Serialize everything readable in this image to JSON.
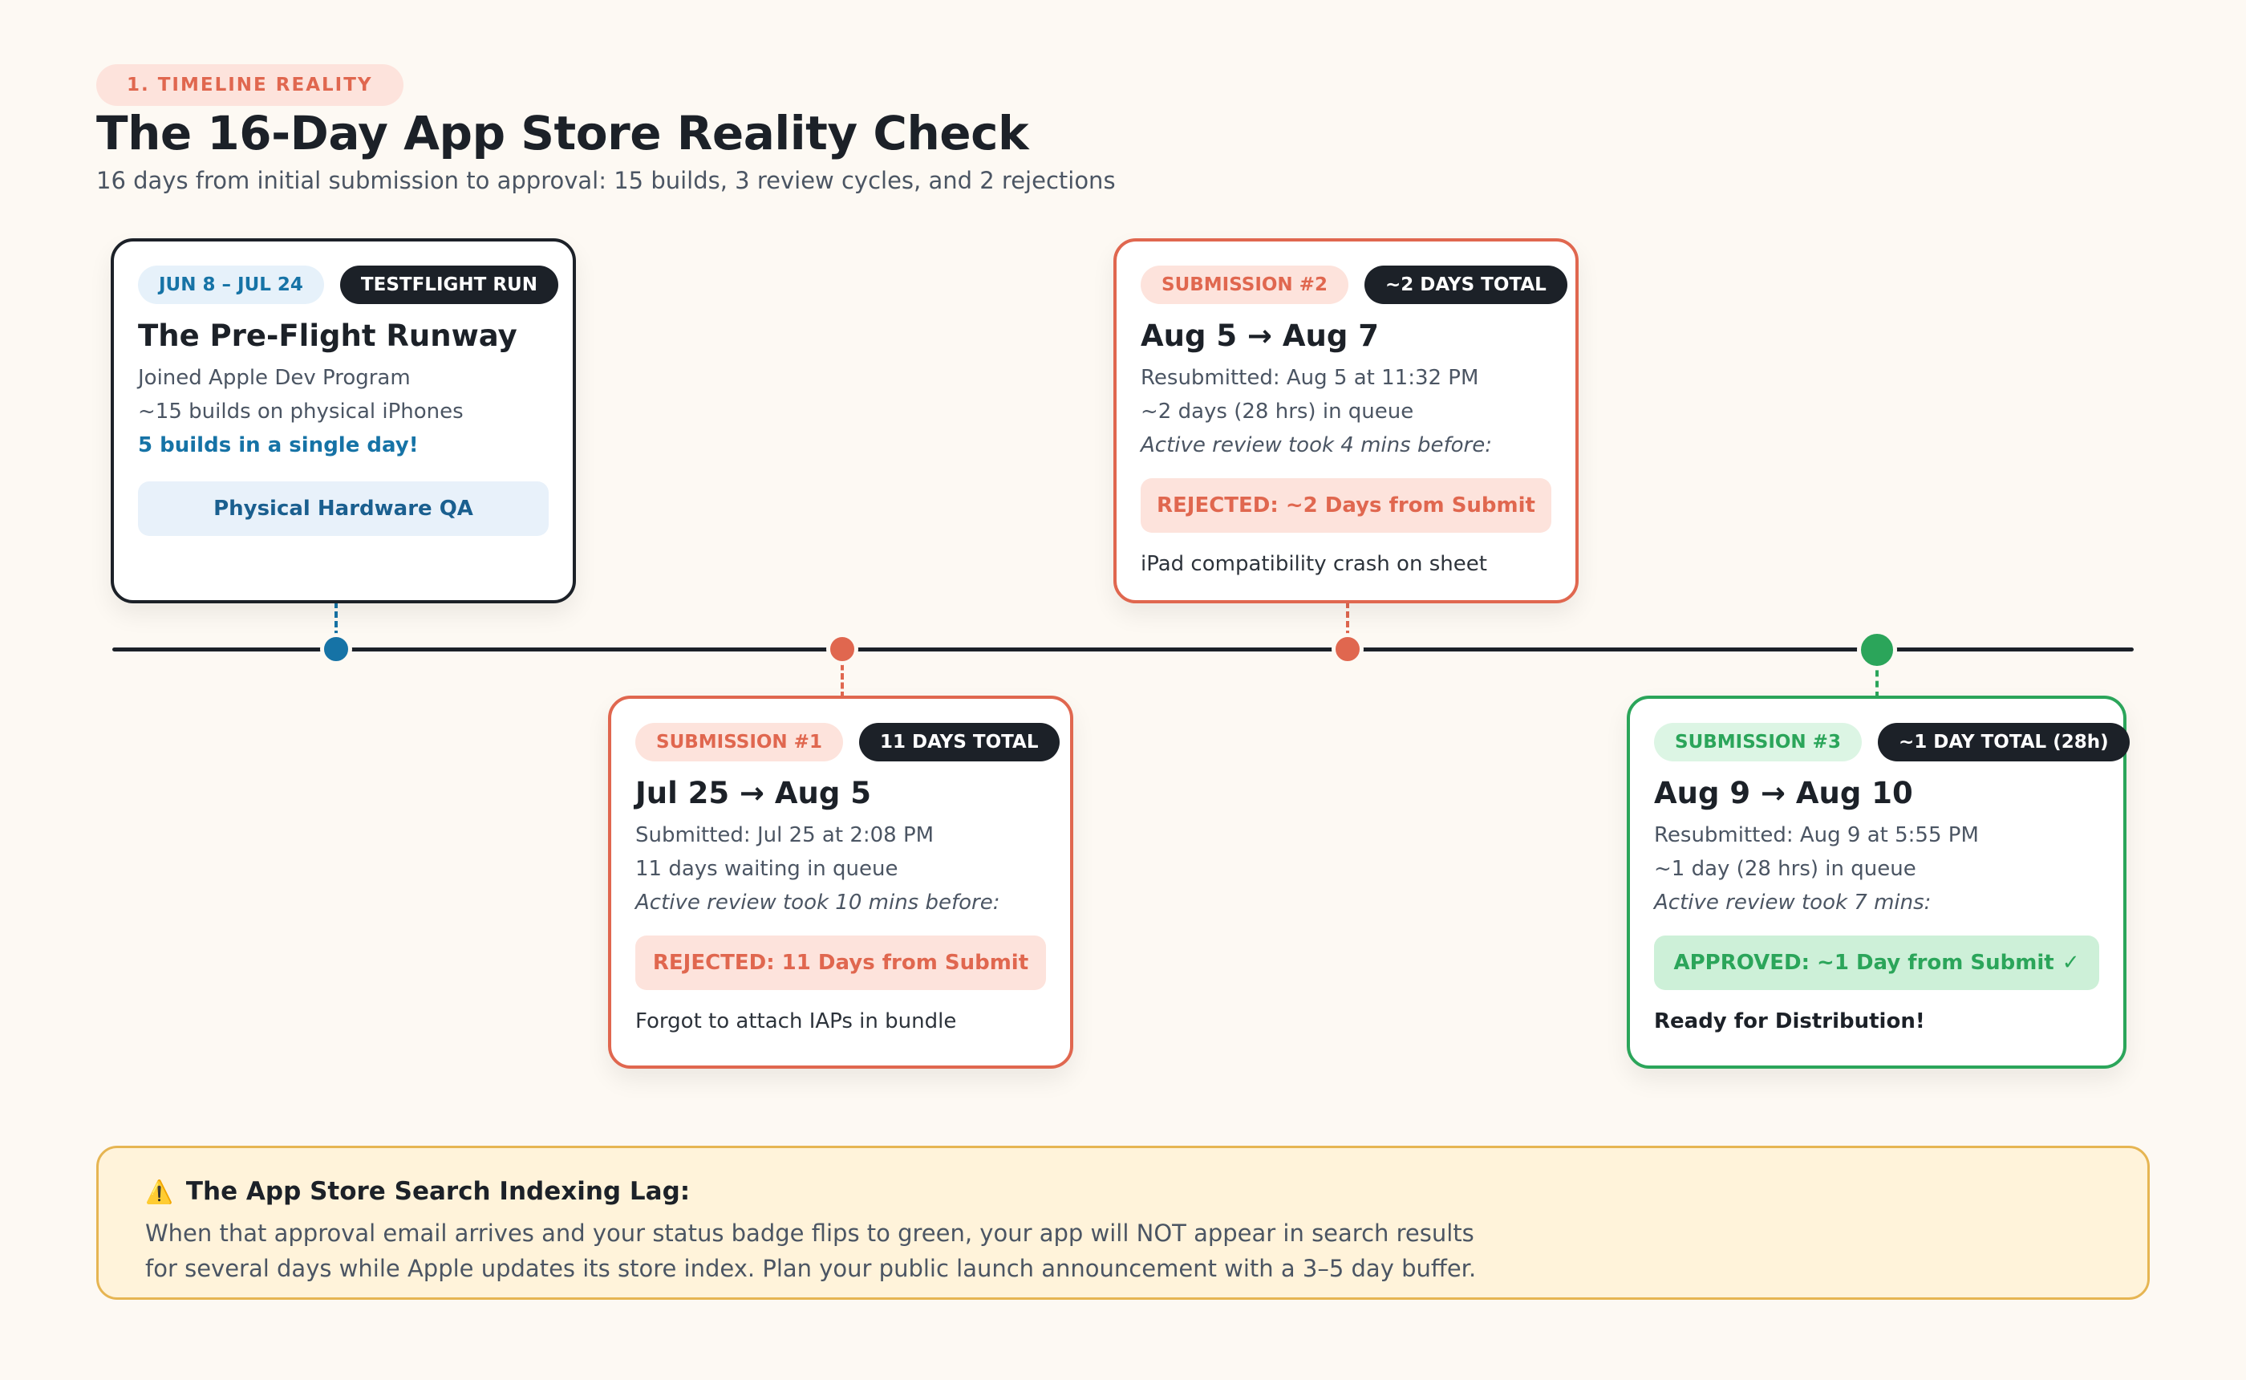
{
  "header": {
    "section_tag": "1. TIMELINE REALITY",
    "title": "The 16-Day App Store Reality Check",
    "subtitle": "16 days from initial submission to approval: 15 builds, 3 review cycles, and 2 rejections"
  },
  "colors": {
    "blue": "#1673a6",
    "red": "#e0674f",
    "green": "#2ba55a",
    "dark": "#1c2128",
    "callout_border": "#e6b552"
  },
  "cards": {
    "testflight": {
      "date_pill": "JUN 8 – JUL 24",
      "stage_pill": "TESTFLIGHT RUN",
      "title": "The Pre-Flight Runway",
      "line1": "Joined Apple Dev Program",
      "line2": "~15 builds on physical iPhones",
      "line3": "5 builds in a single day!",
      "status": "Physical Hardware QA"
    },
    "submission1": {
      "label_pill": "SUBMISSION #1",
      "total_pill": "11 DAYS TOTAL",
      "title": "Jul 25 → Aug 5",
      "line1": "Submitted: Jul 25 at 2:08 PM",
      "line2": "11 days waiting in queue",
      "line3": "Active review took 10 mins before:",
      "status": "REJECTED: 11 Days from Submit",
      "note": "Forgot to attach IAPs in bundle"
    },
    "submission2": {
      "label_pill": "SUBMISSION #2",
      "total_pill": "~2 DAYS TOTAL",
      "title": "Aug 5 → Aug 7",
      "line1": "Resubmitted: Aug 5 at 11:32 PM",
      "line2": "~2 days (28 hrs) in queue",
      "line3": "Active review took 4 mins before:",
      "status": "REJECTED: ~2 Days from Submit",
      "note": "iPad compatibility crash on sheet"
    },
    "submission3": {
      "label_pill": "SUBMISSION #3",
      "total_pill": "~1 DAY TOTAL (28h)",
      "title": "Aug 9 → Aug 10",
      "line1": "Resubmitted: Aug 9 at 5:55 PM",
      "line2": "~1 day (28 hrs) in queue",
      "line3": "Active review took 7 mins:",
      "status": "APPROVED: ~1 Day from Submit",
      "status_icon": "✓",
      "note": "Ready for Distribution!"
    }
  },
  "callout": {
    "icon": "⚠️",
    "title": "The App Store Search Indexing Lag:",
    "body": "When that approval email arrives and your status badge flips to green, your app will NOT appear in search results for several days while Apple updates its store index. Plan your public launch announcement with a 3–5 day buffer."
  }
}
